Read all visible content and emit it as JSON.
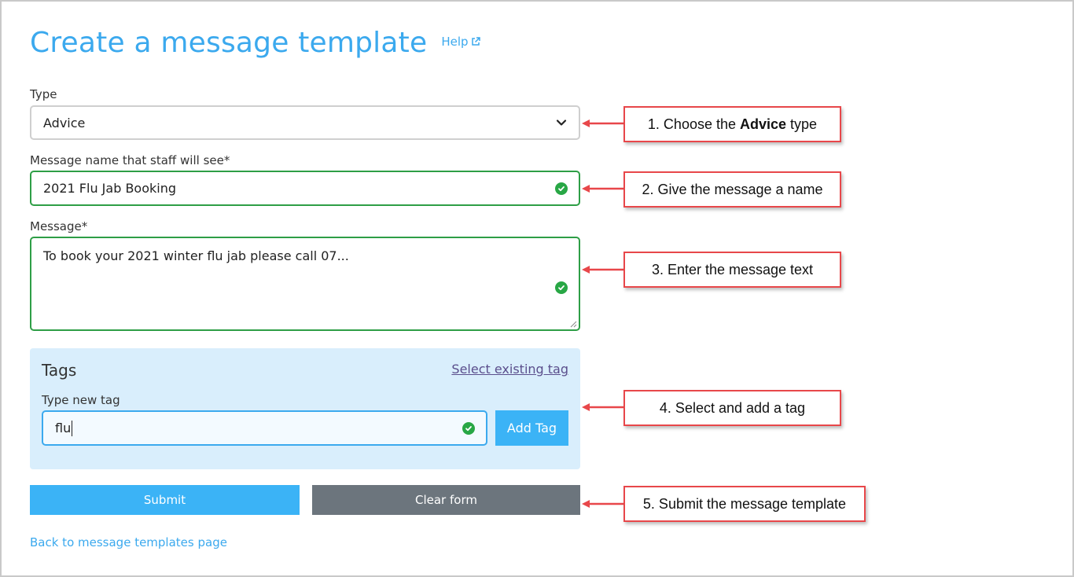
{
  "page": {
    "title": "Create a message template",
    "help_label": "Help"
  },
  "form": {
    "type_label": "Type",
    "type_value": "Advice",
    "name_label": "Message name that staff will see*",
    "name_value": "2021 Flu Jab Booking",
    "message_label": "Message*",
    "message_value": "To book your 2021 winter flu jab please call 07..."
  },
  "tags": {
    "title": "Tags",
    "select_existing": "Select existing tag",
    "new_tag_label": "Type new tag",
    "new_tag_value": "flu",
    "add_button": "Add Tag"
  },
  "actions": {
    "submit": "Submit",
    "clear": "Clear form",
    "back_link": "Back to message templates page"
  },
  "callouts": {
    "c1_prefix": "1. Choose the",
    "c1_bold": "Advice",
    "c1_suffix": "type",
    "c2": "2. Give the message a name",
    "c3": "3. Enter the message text",
    "c4": "4. Select and add a tag",
    "c5": "5. Submit the message template"
  },
  "colors": {
    "accent": "#3ba9ee",
    "valid": "#28a745",
    "callout_border": "#e8474a",
    "clear_button": "#6c757d"
  },
  "icons": {
    "help": "external-link-icon",
    "select": "chevron-down-icon",
    "valid": "check-circle-icon"
  }
}
